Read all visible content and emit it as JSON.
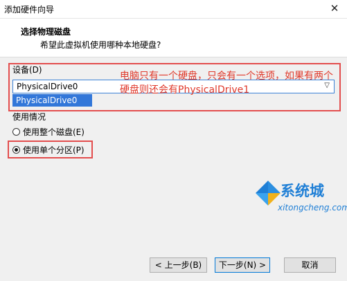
{
  "window": {
    "title": "添加硬件向导",
    "close_glyph": "✕"
  },
  "header": {
    "title": "选择物理磁盘",
    "subtitle": "希望此虚拟机使用哪种本地硬盘?"
  },
  "device": {
    "label": "设备(D)",
    "selected_value": "PhysicalDrive0",
    "options": [
      "PhysicalDrive0"
    ],
    "arrow_glyph": "▽"
  },
  "annotation": {
    "text": "电脑只有一个硬盘，只会有一个选项，如果有两个硬盘则还会有PhysicalDrive1",
    "color": "#e0392b"
  },
  "usage": {
    "label": "使用情况",
    "options": [
      {
        "label": "使用整个磁盘(E)",
        "checked": false
      },
      {
        "label": "使用单个分区(P)",
        "checked": true
      }
    ]
  },
  "buttons": {
    "back": "< 上一步(B)",
    "next": "下一步(N) >",
    "cancel": "取消"
  },
  "watermark": {
    "name": "系统城",
    "url": "xitongcheng.com",
    "color": "#1f7fd6"
  },
  "colors": {
    "highlight": "#3277d9",
    "annotation_border": "#e34d4d",
    "dialog_bg": "#f0f0f0"
  }
}
